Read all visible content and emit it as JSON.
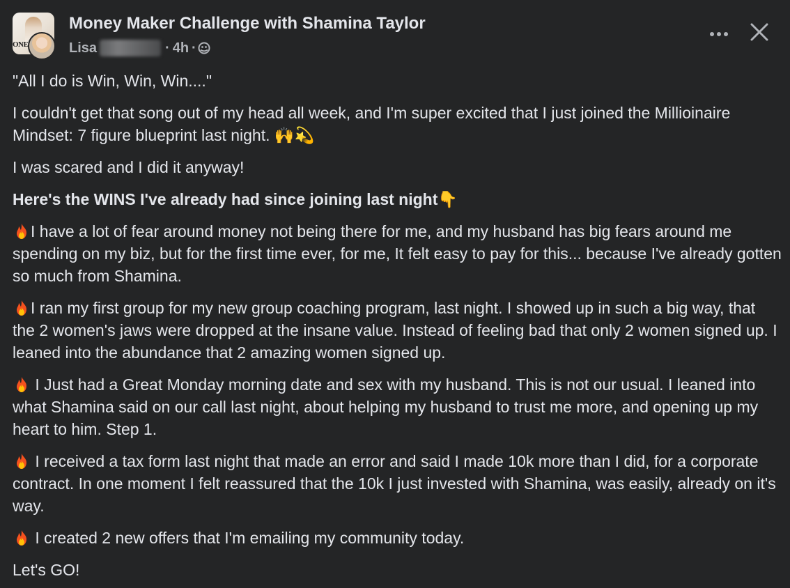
{
  "post": {
    "group_name": "Money Maker Challenge with Shamina Taylor",
    "author_name": "Lisa",
    "separator": "·",
    "timestamp": "4h",
    "privacy_icon": "globe-icon",
    "more_icon": "more-options-icon",
    "close_icon": "close-icon",
    "avatar_text": "ONE"
  },
  "content": {
    "p1": "\"All I do is Win, Win, Win....\"",
    "p2": "I couldn't get that song out of my head all week, and I'm super excited that I just joined the Millioinaire Mindset: 7 figure blueprint last night. 🙌💫",
    "p3": "I was scared and I did it anyway!",
    "p4": "Here's the WINS I've already had since joining last night👇",
    "p5": "I have a lot of fear around money not being there for me, and my husband has big fears around me spending on my biz, but for the first time ever, for me, It felt easy to pay for this... because I've already gotten so much from Shamina.",
    "p6": "I ran my first group for my new group coaching program, last night. I showed up in such a big way, that the 2 women's jaws were dropped at the insane value. Instead of feeling bad that only 2 women signed up. I leaned into the abundance that 2 amazing women signed up.",
    "p7": " I Just had a Great Monday morning date and sex with my husband. This is not our usual. I leaned into what Shamina said on our call last night, about helping my husband to trust me more, and opening up my heart to him. Step 1.",
    "p8": " I received a tax form last night that made an error and said I made 10k more than I did, for a corporate contract. In one moment I felt reassured that the 10k I just invested with Shamina, was easily, already on it's way.",
    "p9": " I created 2 new offers that I'm emailing my community today.",
    "p10": "Let's GO!"
  },
  "colors": {
    "background": "#242526",
    "primary_text": "#e4e6eb",
    "secondary_text": "#b0b3b8"
  }
}
